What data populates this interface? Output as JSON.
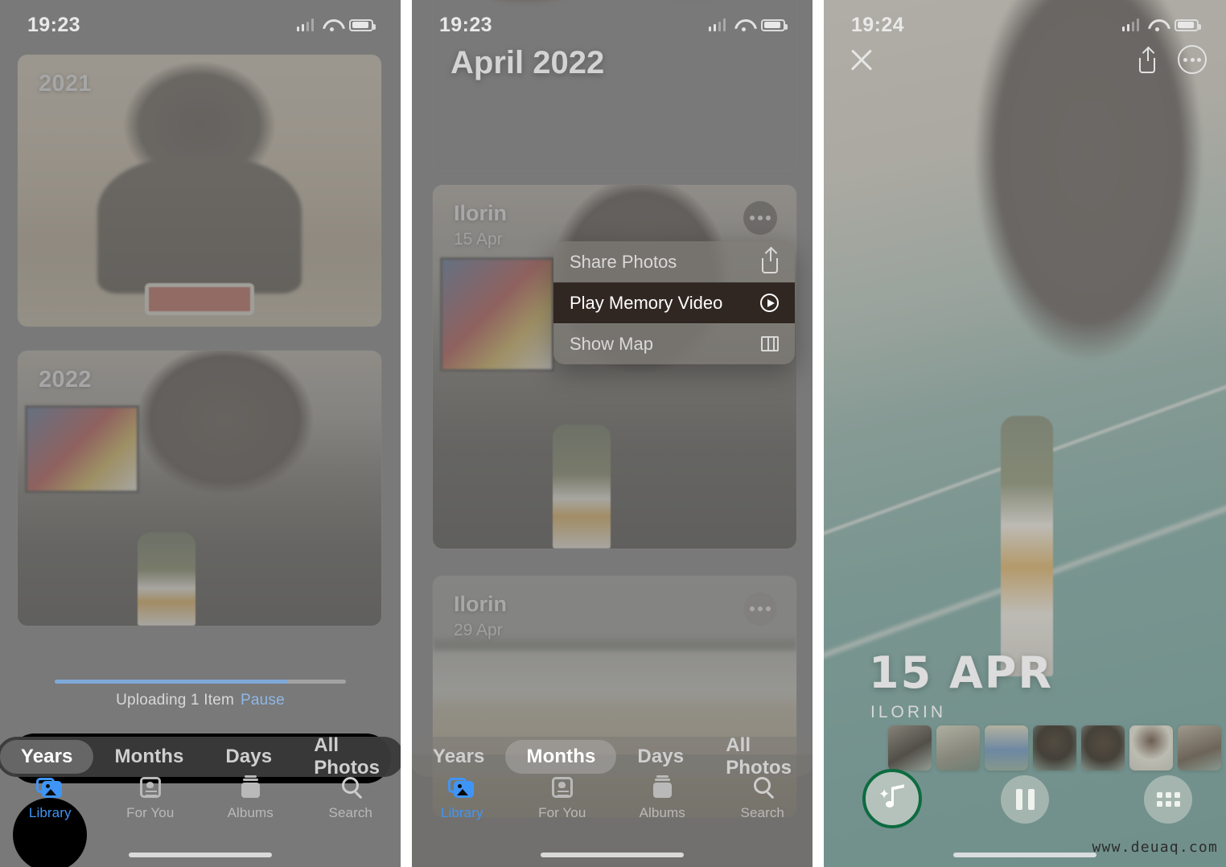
{
  "panels": [
    {
      "name": "years-view",
      "status": {
        "time": "19:23",
        "signal": "cellular-bars",
        "wifi": "wifi-icon",
        "battery": "battery-icon"
      },
      "cards": [
        {
          "label": "2021",
          "photo": "man-seated-classroom"
        },
        {
          "label": "2022",
          "photo": "man-drinking-maltina"
        }
      ],
      "upload": {
        "text": "Uploading 1 Item",
        "action": "Pause",
        "progress_percent": 80
      },
      "segmented": {
        "items": [
          "Years",
          "Months",
          "Days",
          "All Photos"
        ],
        "selected": "Years"
      },
      "tabs": [
        {
          "label": "Library",
          "icon": "library-icon",
          "active": true
        },
        {
          "label": "For You",
          "icon": "heart-card-icon",
          "active": false
        },
        {
          "label": "Albums",
          "icon": "albums-icon",
          "active": false
        },
        {
          "label": "Search",
          "icon": "search-icon",
          "active": false
        }
      ]
    },
    {
      "name": "months-view",
      "status": {
        "time": "19:23"
      },
      "month_header": "April 2022",
      "cards": [
        {
          "title": "Ilorin",
          "sub": "15 Apr",
          "photo": "bar-table-scene",
          "menu_open": true
        },
        {
          "title": "Ilorin",
          "sub": "29 Apr",
          "photo": "river-field-landscape",
          "menu_open": false
        }
      ],
      "context_menu": [
        {
          "label": "Share Photos",
          "icon": "share-icon",
          "highlighted": false
        },
        {
          "label": "Play Memory Video",
          "icon": "replay-icon",
          "highlighted": true
        },
        {
          "label": "Show Map",
          "icon": "map-icon",
          "highlighted": false
        }
      ],
      "segmented": {
        "items": [
          "Years",
          "Months",
          "Days",
          "All Photos"
        ],
        "selected": "Months"
      },
      "tabs": [
        {
          "label": "Library",
          "icon": "library-icon",
          "active": true
        },
        {
          "label": "For You",
          "icon": "heart-card-icon",
          "active": false
        },
        {
          "label": "Albums",
          "icon": "albums-icon",
          "active": false
        },
        {
          "label": "Search",
          "icon": "search-icon",
          "active": false
        }
      ]
    },
    {
      "name": "memory-player",
      "status": {
        "time": "19:24"
      },
      "close_icon": "close-icon",
      "share_icon": "share-icon",
      "more_icon": "more-options-icon",
      "memory": {
        "title": "15 APR",
        "subtitle": "ILORIN"
      },
      "controls": {
        "music": {
          "icon": "music-sparkle-icon",
          "ring_color": "#0d6b40"
        },
        "pause": {
          "icon": "pause-icon"
        },
        "grid": {
          "icon": "grid-icon"
        }
      },
      "filmstrip_count": 7
    }
  ],
  "watermark": "www.deuaq.com",
  "colors": {
    "accent_blue": "#3f95f5",
    "progress_blue": "#7fa9d8",
    "music_ring_green": "#0d6b40",
    "menu_highlight": "#302622"
  }
}
